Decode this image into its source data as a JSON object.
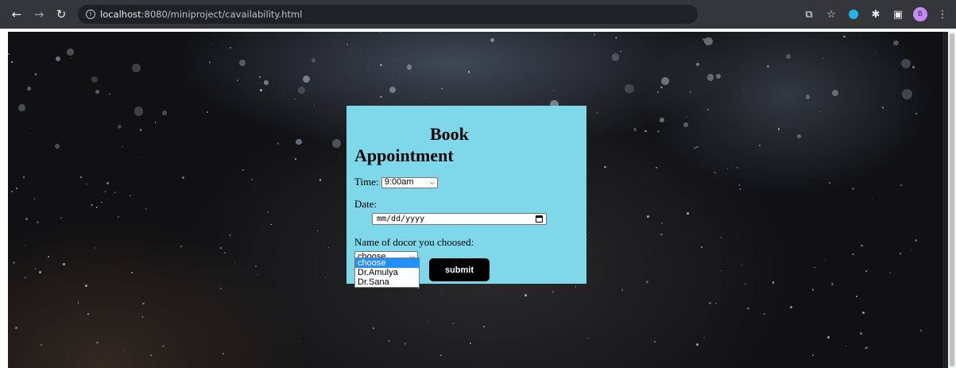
{
  "browser": {
    "back_icon": "arrow-left-icon",
    "forward_icon": "arrow-right-icon",
    "reload_icon": "reload-icon",
    "url_host": "localhost",
    "url_rest": ":8080/miniproject/cavailability.html",
    "profile_initial": "B"
  },
  "form": {
    "title_line1": "Book",
    "title_line2": "Appointment",
    "time_label": "Time:",
    "time_value": "9:00am",
    "date_label": "Date:",
    "date_placeholder": "mm/dd/yyyy",
    "doctor_label": "Name of docor you choosed:",
    "doctor_value": "choose",
    "doctor_options": [
      "choose",
      "Dr.Amulya",
      "Dr.Sana"
    ],
    "submit_label": "submit"
  },
  "colors": {
    "card_background": "#7fd8ea",
    "submit_background": "#000000",
    "dropdown_selected": "#1e90ff"
  }
}
